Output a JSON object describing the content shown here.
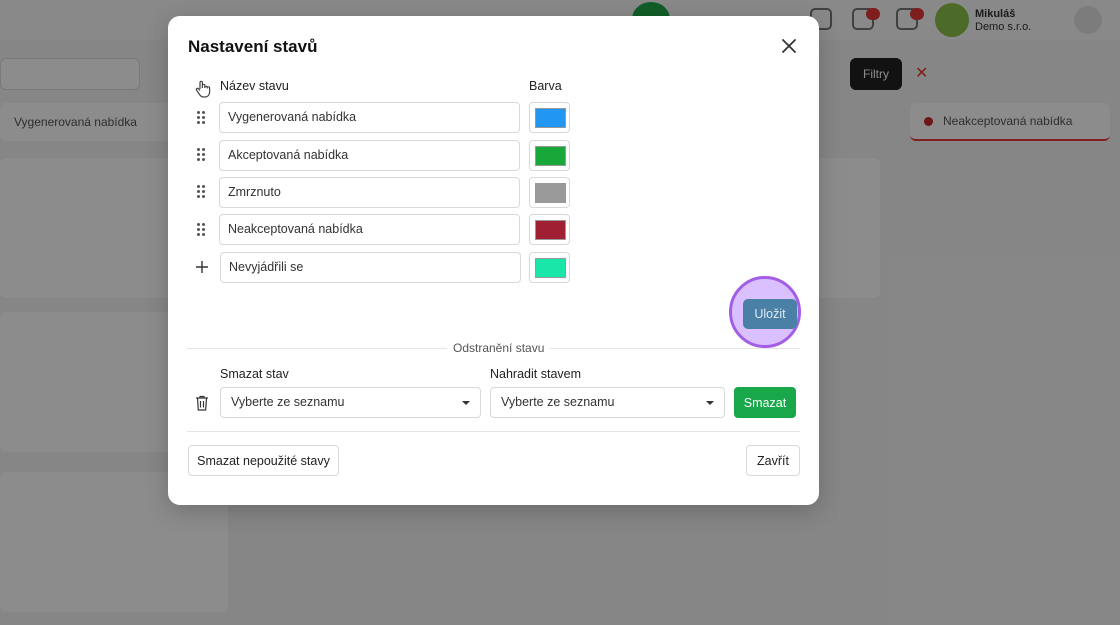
{
  "background": {
    "user_name": "Mikuláš",
    "user_sub": "Demo s.r.o.",
    "filter_label": "Filtry",
    "columns": [
      "Vygenerovaná nabídka",
      "Neakceptovaná nabídka"
    ]
  },
  "modal": {
    "title": "Nastavení stavů",
    "name_header": "Název stavu",
    "color_header": "Barva",
    "states": [
      {
        "name": "Vygenerovaná nabídka",
        "color": "#2196f3"
      },
      {
        "name": "Akceptovaná nabídka",
        "color": "#18a83a"
      },
      {
        "name": "Zmrznuto",
        "color": "#9a9a9a"
      },
      {
        "name": "Neakceptovaná nabídka",
        "color": "#a11f33"
      }
    ],
    "new_state": {
      "name": "Nevyjádřili se",
      "color": "#19e6a8"
    },
    "save_label": "Uložit",
    "removal_section": "Odstranění stavu",
    "delete_state_label": "Smazat stav",
    "replace_state_label": "Nahradit stavem",
    "delete_select_value": "Vyberte ze seznamu",
    "replace_select_value": "Vyberte ze seznamu",
    "delete_button": "Smazat",
    "delete_unused_button": "Smazat nepoužité stavy",
    "close_button": "Zavřít"
  }
}
